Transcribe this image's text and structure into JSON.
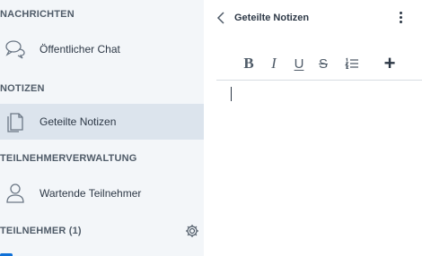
{
  "sidebar": {
    "sections": {
      "messages": "NACHRICHTEN",
      "notes": "NOTIZEN",
      "user_management": "TEILNEHMERVERWALTUNG",
      "participants": "TEILNEHMER (1)"
    },
    "items": [
      {
        "label": "Öffentlicher Chat",
        "icon": "chat-bubbles-icon"
      },
      {
        "label": "Geteilte Notizen",
        "icon": "notes-icon",
        "active": true
      },
      {
        "label": "Wartende Teilnehmer",
        "icon": "user-icon"
      }
    ]
  },
  "panel": {
    "title": "Geteilte Notizen",
    "toolbar": {
      "bold": "B",
      "italic": "I",
      "underline": "U",
      "strike": "S",
      "add": "+"
    },
    "editor_text": ""
  },
  "colors": {
    "sidebar_bg": "#f3f6f9",
    "active_item_bg": "#dce4ed",
    "text": "#2d3846",
    "accent": "#0f70d7"
  }
}
